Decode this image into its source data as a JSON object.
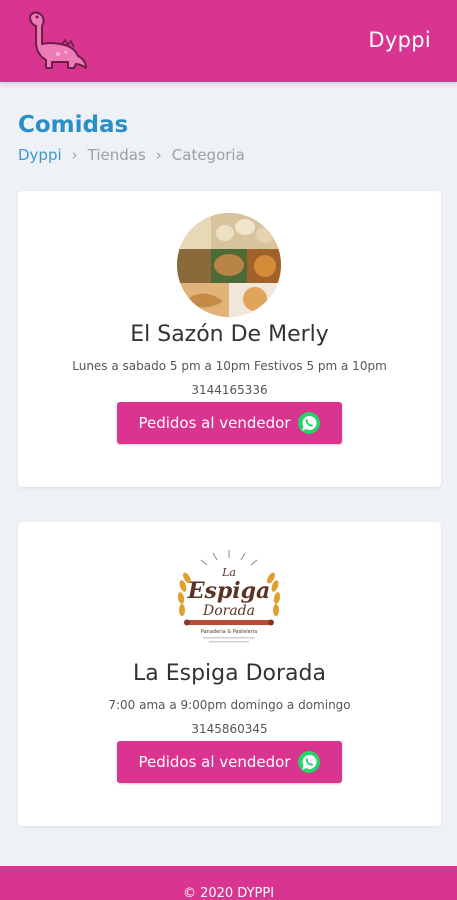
{
  "header": {
    "brand": "Dyppi",
    "logo_icon": "dinosaur-logo-icon",
    "bg_color": "#d9348f"
  },
  "page": {
    "title": "Comidas",
    "breadcrumb": [
      "Dyppi",
      "Tiendas",
      "Categoria"
    ]
  },
  "stores": [
    {
      "name": "El Sazón De Merly",
      "hours": "Lunes a sabado 5 pm a 10pm Festivos 5 pm a 10pm",
      "phone": "3144165336",
      "button_label": "Pedidos al vendedor",
      "image_icon": "food-collage-image"
    },
    {
      "name": "La Espiga Dorada",
      "hours": "7:00 ama a 9:00pm domingo a domingo",
      "phone": "3145860345",
      "button_label": "Pedidos al vendedor",
      "image_icon": "espiga-dorada-logo",
      "logo_text": {
        "la": "La",
        "espiga": "Espiga",
        "dorada": "Dorada",
        "tagline": "Panadería & Pastelería"
      }
    }
  ],
  "footer": {
    "text": "© 2020 DYPPI"
  },
  "colors": {
    "accent": "#d9348f",
    "title": "#2a8fc7",
    "whatsapp": "#25d366"
  }
}
